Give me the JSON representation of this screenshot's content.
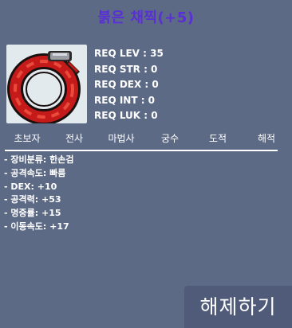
{
  "item": {
    "name": "붉은 채찍(+5)",
    "icon": "red-whip-icon"
  },
  "requirements": [
    "REQ LEV : 35",
    "REQ STR : 0",
    "REQ DEX : 0",
    "REQ INT : 0",
    "REQ LUK : 0"
  ],
  "jobs": [
    "초보자",
    "전사",
    "마법사",
    "궁수",
    "도적",
    "해적"
  ],
  "stats": [
    "- 장비분류: 한손검",
    "- 공격속도: 빠름",
    "- DEX: +10",
    "- 공격력: +53",
    "- 명중률: +15",
    "- 이동속도: +17"
  ],
  "unequip_label": "해제하기",
  "colors": {
    "title": "#5a2fd6",
    "background": "#5d6a86",
    "button": "#4f5b78",
    "text": "#ffffff"
  }
}
